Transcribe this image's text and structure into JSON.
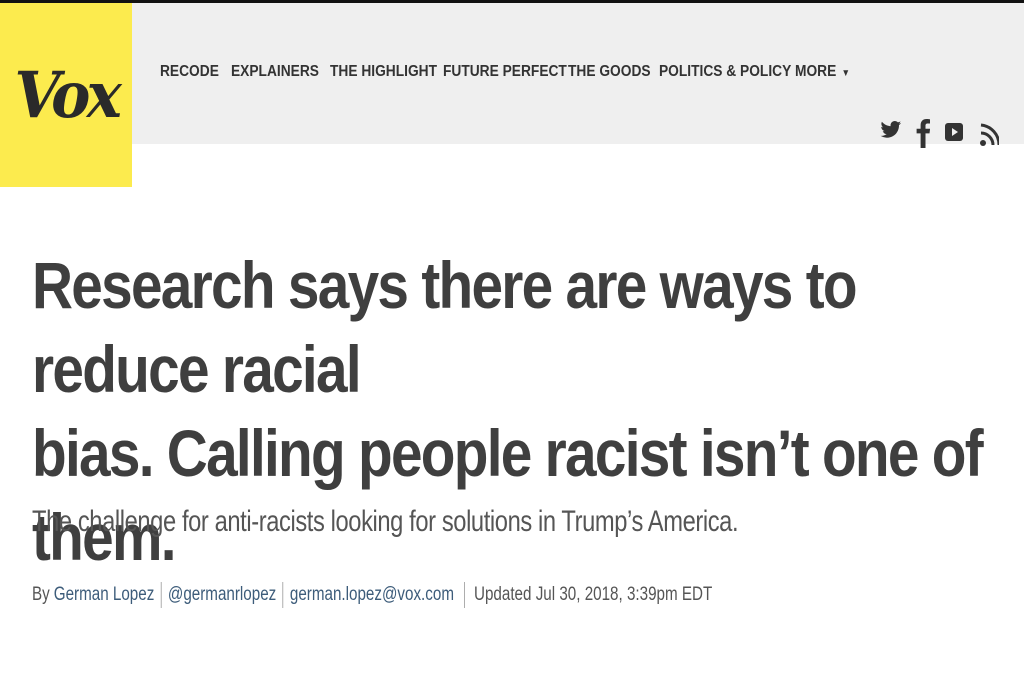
{
  "brand": {
    "logo_text": "Vox",
    "logo_color": "#fceb4e"
  },
  "nav": {
    "items": [
      {
        "label": "RECODE"
      },
      {
        "label": "EXPLAINERS"
      },
      {
        "label": "THE HIGHLIGHT"
      },
      {
        "label": "FUTURE PERFECT"
      },
      {
        "label": "THE GOODS"
      },
      {
        "label": "POLITICS & POLICY"
      }
    ],
    "more_label": "MORE",
    "more_caret": "▼"
  },
  "social": {
    "icons": [
      "twitter-icon",
      "facebook-icon",
      "youtube-icon",
      "rss-icon"
    ]
  },
  "article": {
    "headline_line1": "Research says there are ways to reduce racial",
    "headline_line2": "bias. Calling people racist isn’t one of them.",
    "dek": "The challenge for anti-racists looking for solutions in Trump’s America.",
    "byline": {
      "prefix": "By",
      "author": "German Lopez",
      "twitter": "@germanrlopez",
      "email": "german.lopez@vox.com",
      "updated": "Updated Jul 30, 2018, 3:39pm EDT"
    }
  }
}
